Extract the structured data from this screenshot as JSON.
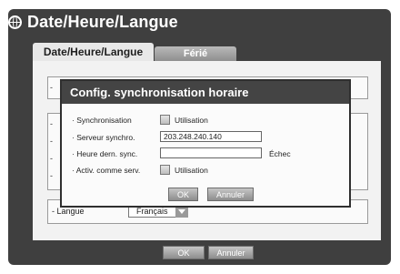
{
  "window": {
    "title": "Date/Heure/Langue"
  },
  "tabs": [
    {
      "label": "Date/Heure/Langue",
      "active": true
    },
    {
      "label": "Férié",
      "active": false
    }
  ],
  "panel": {
    "dashes": [
      "-",
      "-",
      "-",
      "-",
      "-"
    ],
    "language": {
      "label": "Langue",
      "value": "Français"
    }
  },
  "dialog": {
    "title": "Config. synchronisation horaire",
    "rows": {
      "sync": {
        "label": "Synchronisation",
        "checkbox_label": "Utilisation",
        "checked": false
      },
      "server": {
        "label": "Serveur synchro.",
        "value": "203.248.240.140"
      },
      "last_sync": {
        "label": "Heure dern. sync.",
        "value": "",
        "status": "Échec"
      },
      "as_server": {
        "label": "Activ. comme serv.",
        "checkbox_label": "Utilisation",
        "checked": false
      }
    },
    "buttons": {
      "ok": "OK",
      "cancel": "Annuler"
    }
  },
  "footer": {
    "ok": "OK",
    "cancel": "Annuler"
  },
  "colors": {
    "frame": "#3f3f3f",
    "panel": "#f2f2f2",
    "dialog_header": "#444444"
  }
}
